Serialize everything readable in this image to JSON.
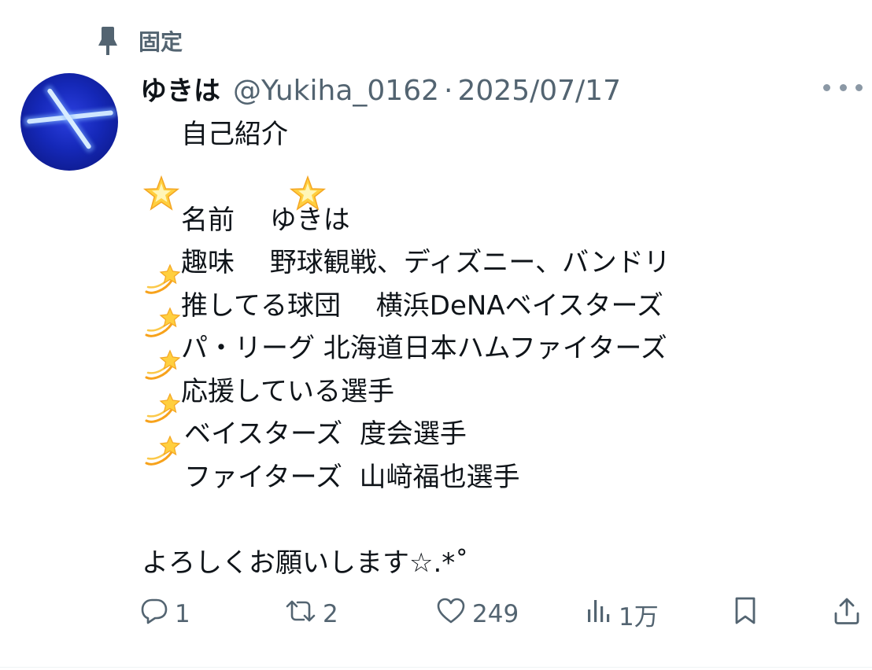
{
  "pinned": {
    "label": "固定"
  },
  "author": {
    "display_name": "ゆきは",
    "handle": "@Yukiha_0162",
    "separator": "·",
    "date": "2025/07/17"
  },
  "tweet": {
    "lines": [
      "自己紹介",
      "",
      "名前　 ゆきは",
      "趣味　 野球観戦、ディズニー、バンドリ",
      "推してる球団　 横浜DeNAベイスターズ",
      "パ・リーグ 北海道日本ハムファイターズ",
      "応援している選手",
      "ベイスターズ  度会選手",
      "ファイターズ  山﨑福也選手",
      "",
      "よろしくお願いします☆.*˚"
    ]
  },
  "actions": {
    "replies": "1",
    "reposts": "2",
    "likes": "249",
    "views": "1万"
  },
  "icons": {
    "pin": "pin-icon",
    "more": "more-icon",
    "star_emoji": "glowing-star-emoji",
    "dizzy_emoji": "dizzy-emoji",
    "reply": "reply-icon",
    "repost": "repost-icon",
    "like": "heart-icon",
    "views": "views-icon",
    "bookmark": "bookmark-icon",
    "share": "share-icon"
  },
  "colors": {
    "text": "#0f1419",
    "secondary": "#536471",
    "avatar_blue": "#1528b8"
  }
}
